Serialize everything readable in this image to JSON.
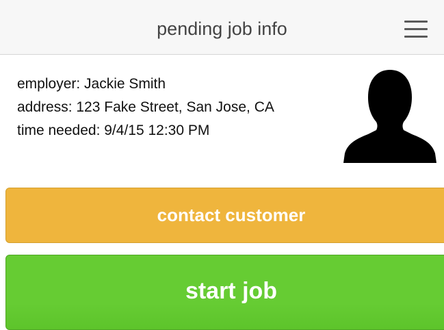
{
  "header": {
    "title": "pending job info",
    "menu_icon": "hamburger-menu-icon"
  },
  "job": {
    "employer": "employer: Jackie Smith",
    "address": "address: 123 Fake Street, San Jose, CA",
    "time_needed": "time needed: 9/4/15 12:30 PM",
    "avatar_icon": "user-silhouette-icon"
  },
  "actions": {
    "contact_label": "contact customer",
    "start_label": "start job"
  },
  "colors": {
    "header_bg": "#f7f7f7",
    "contact_button": "#efb53d",
    "start_button": "#66cc33",
    "avatar": "#000000"
  }
}
